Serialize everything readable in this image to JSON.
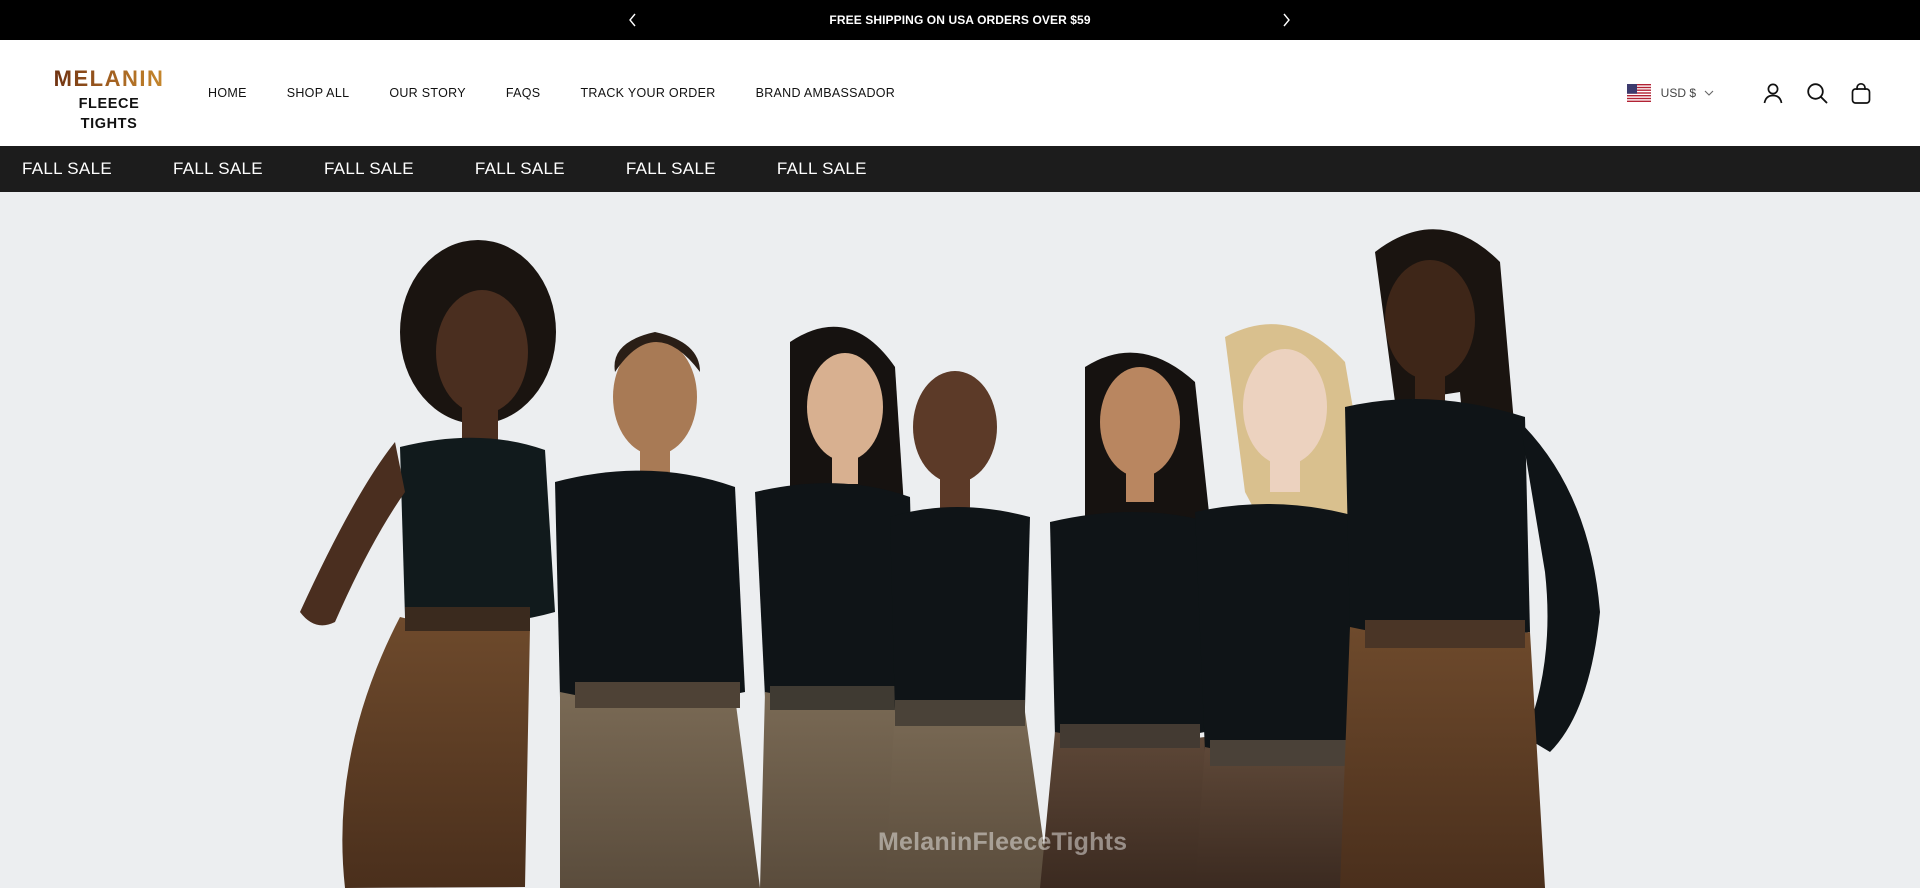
{
  "announcement": {
    "text": "FREE SHIPPING ON USA ORDERS OVER $59",
    "prev_icon": "chevron-left-icon",
    "next_icon": "chevron-right-icon"
  },
  "logo": {
    "line1": "MELANIN",
    "line2": "FLEECE TIGHTS"
  },
  "nav": {
    "items": [
      {
        "label": "HOME"
      },
      {
        "label": "SHOP ALL"
      },
      {
        "label": "OUR STORY"
      },
      {
        "label": "FAQS"
      },
      {
        "label": "TRACK YOUR ORDER"
      },
      {
        "label": "BRAND AMBASSADOR"
      }
    ]
  },
  "header_actions": {
    "currency": "USD $",
    "currency_flag_icon": "us-flag-icon",
    "account_icon": "account-icon",
    "search_icon": "search-icon",
    "cart_icon": "shopping-bag-icon"
  },
  "marquee": {
    "items": [
      "FALL SALE",
      "FALL SALE",
      "FALL SALE",
      "FALL SALE",
      "FALL SALE",
      "FALL SALE"
    ]
  },
  "hero": {
    "watermark": "MelaninFleeceTights"
  },
  "colors": {
    "announcement_bg": "#000000",
    "marquee_bg": "#1c1c1c",
    "hero_bg": "#eceef0",
    "brand_gradient_start": "#6b2f10",
    "brand_gradient_end": "#c98b2e"
  }
}
